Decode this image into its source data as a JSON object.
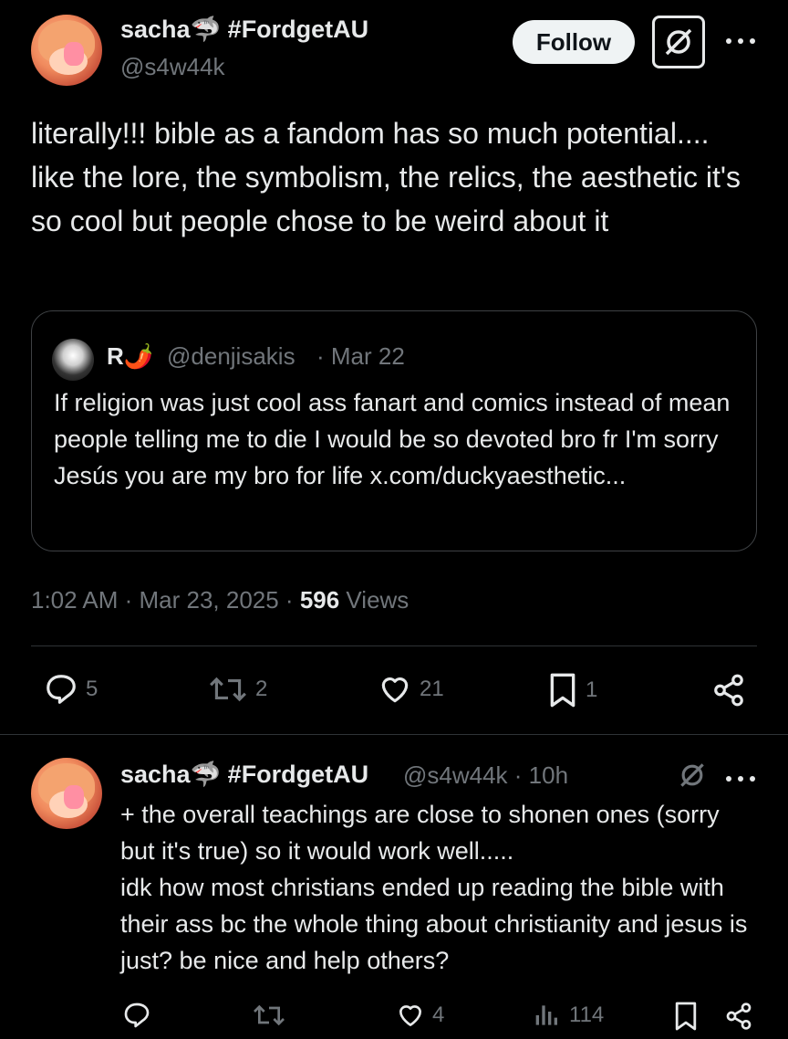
{
  "main_post": {
    "author_name": "sacha🦈 #FordgetAU",
    "author_handle": "@s4w44k",
    "follow_label": "Follow",
    "text": "literally!!! bible as a fandom has so much potential.... like the lore, the symbolism, the relics, the aesthetic it's so cool but people chose to be weird about it",
    "quote": {
      "author_name": "R🌶️",
      "author_handle": "@denjisakis",
      "date": "· Mar 22",
      "text": "If religion was just cool ass fanart and comics instead of mean people telling me to die I would be so devoted bro fr I'm sorry Jesús you are my bro for life x.com/duckyaesthetic..."
    },
    "timestamp": "1:02 AM · Mar 23, 2025 · ",
    "views_count": "596",
    "views_label": " Views",
    "actions": {
      "replies": "5",
      "reposts": "2",
      "likes": "21",
      "bookmarks": "1"
    }
  },
  "reply_post": {
    "author_name": "sacha🦈 #FordgetAU",
    "author_handle": "@s4w44k · 10h",
    "text": "+ the overall teachings are close to shonen ones (sorry but it's true) so it would work well.....\nidk how most christians ended up reading the bible with their ass bc the whole thing about christianity and jesus is just? be nice and help others?",
    "actions": {
      "likes": "4",
      "views": "114"
    }
  }
}
